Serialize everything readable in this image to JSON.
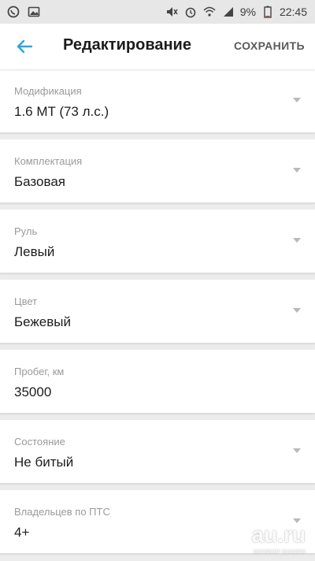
{
  "status_bar": {
    "battery": "9%",
    "time": "22:45"
  },
  "header": {
    "title": "Редактирование",
    "save_label": "СОХРАНИТЬ"
  },
  "fields": [
    {
      "label": "Модификация",
      "value": "1.6 MT (73 л.с.)"
    },
    {
      "label": "Комплектация",
      "value": "Базовая"
    },
    {
      "label": "Руль",
      "value": "Левый"
    },
    {
      "label": "Цвет",
      "value": "Бежевый"
    },
    {
      "label": "Пробег, км",
      "value": "35000"
    },
    {
      "label": "Состояние",
      "value": "Не битый"
    },
    {
      "label": "Владельцев по ПТС",
      "value": "4+"
    }
  ],
  "watermark": {
    "main": "au.ru",
    "sub": "интернет-аукцион"
  },
  "colors": {
    "accent": "#2aa6e0",
    "background": "#ececec",
    "card": "#ffffff"
  }
}
